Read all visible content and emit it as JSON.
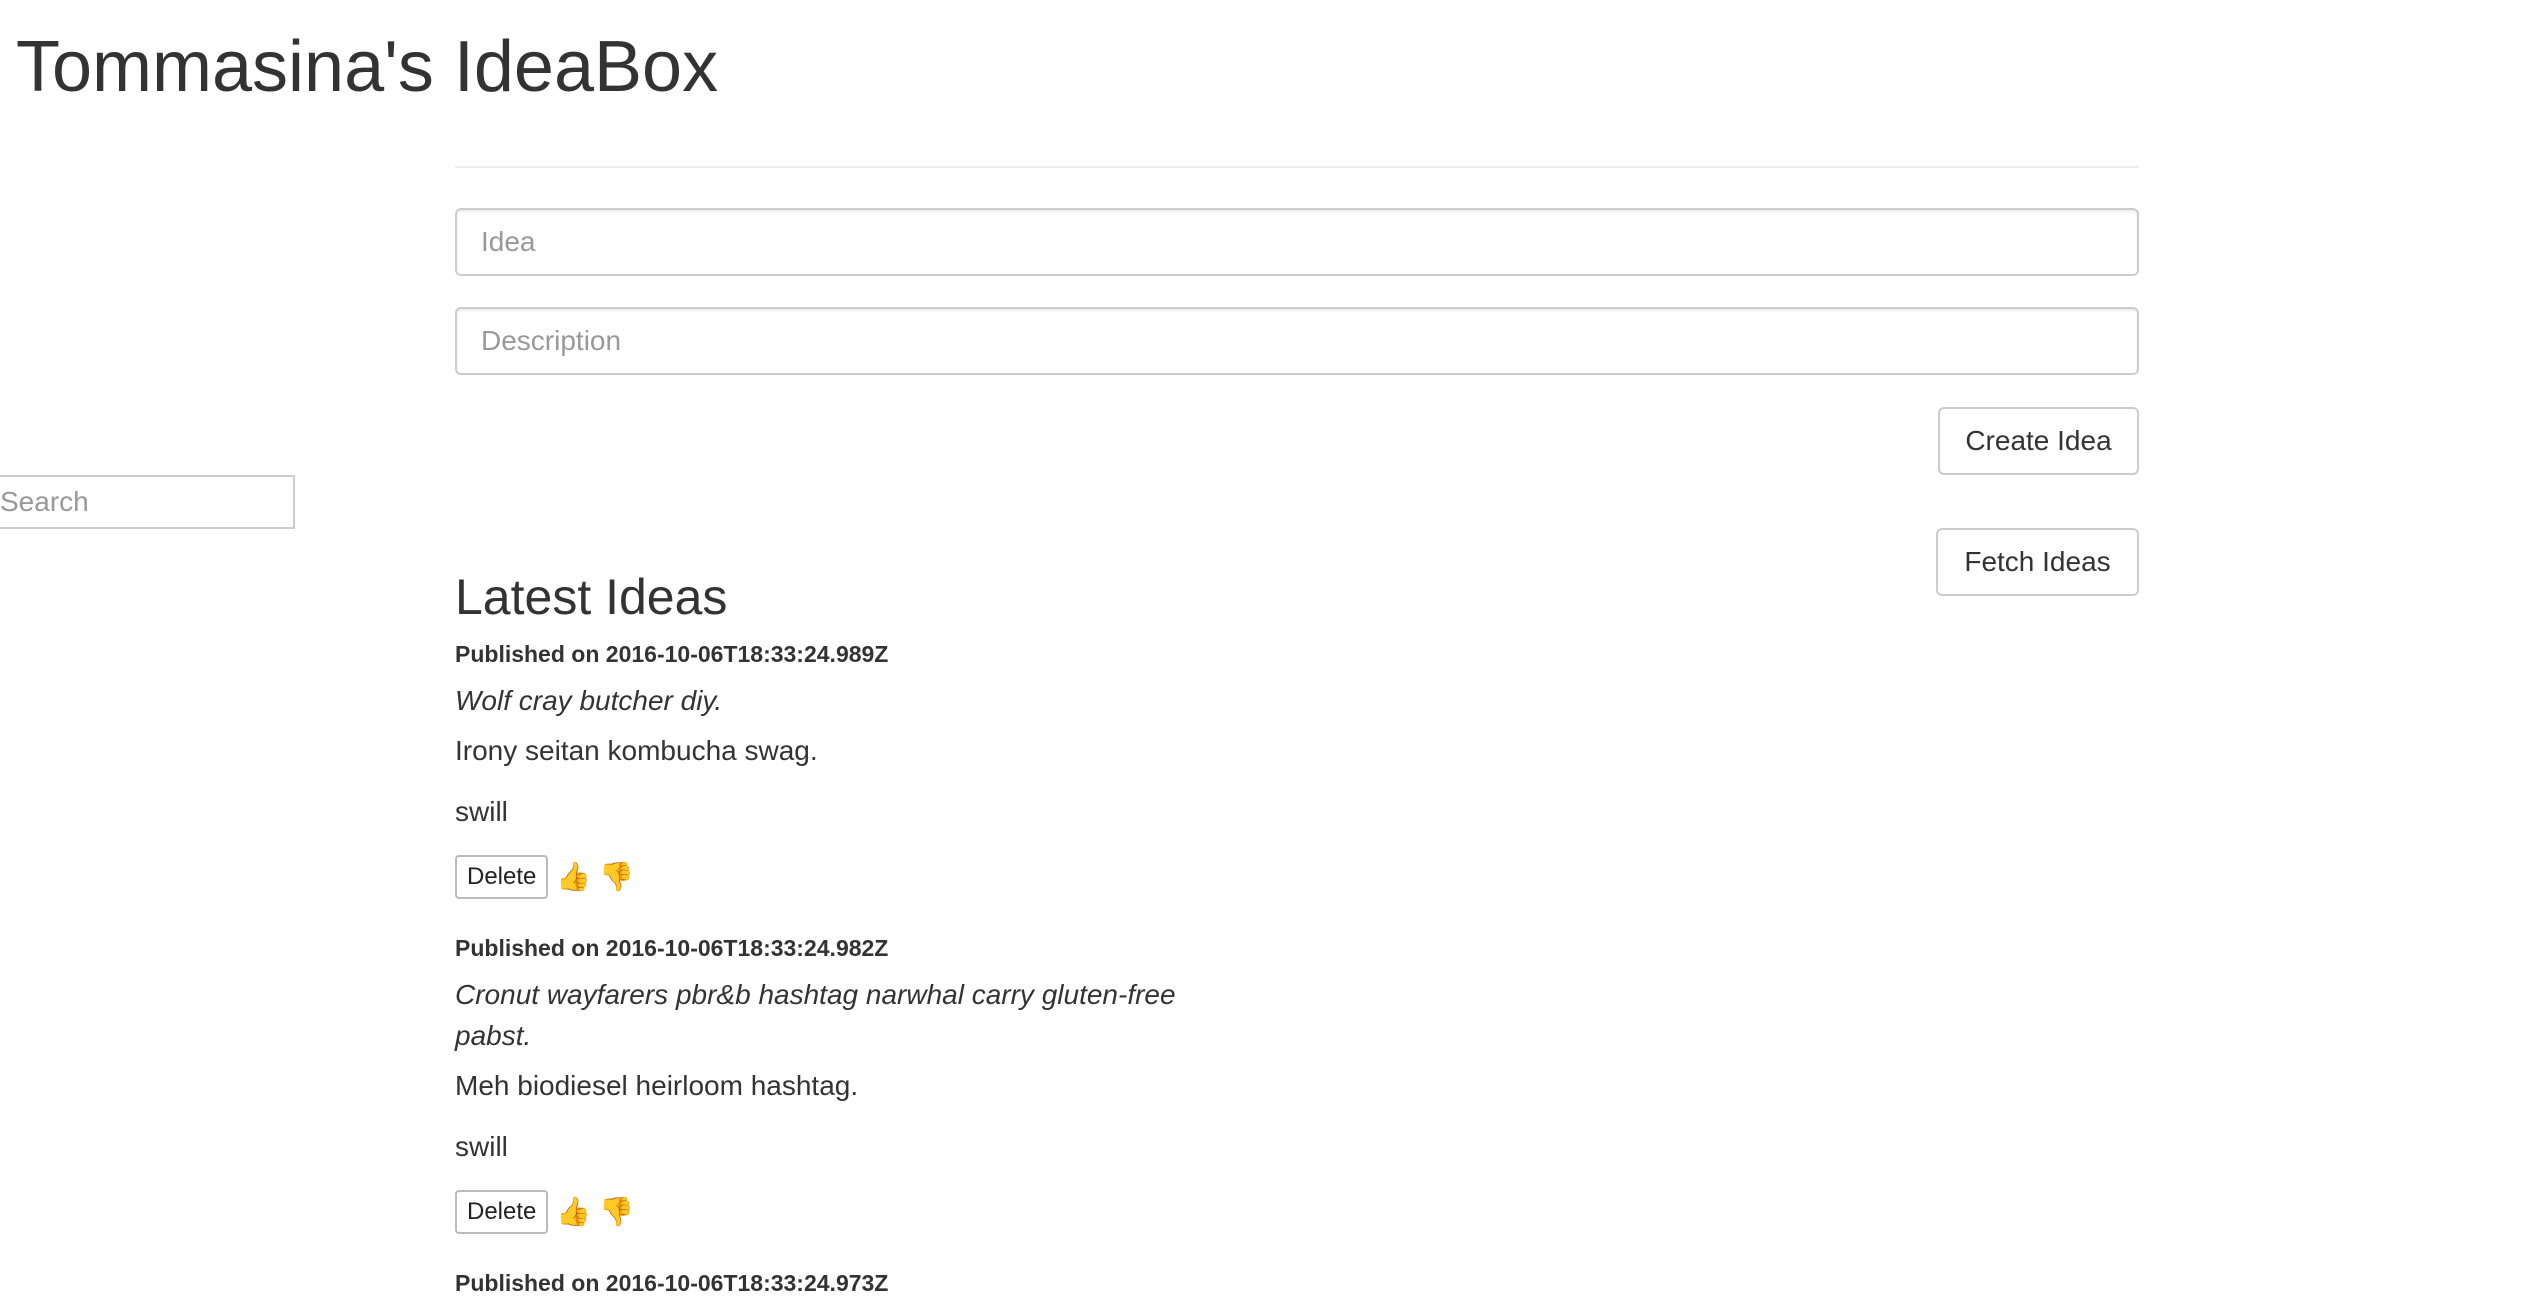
{
  "header": {
    "title": "Tommasina's IdeaBox"
  },
  "form": {
    "idea_placeholder": "Idea",
    "description_placeholder": "Description",
    "create_label": "Create Idea"
  },
  "search": {
    "placeholder": "Search"
  },
  "fetch": {
    "label": "Fetch Ideas"
  },
  "ideas_section": {
    "title": "Latest Ideas",
    "ideas": [
      {
        "published": "Published on 2016-10-06T18:33:24.989Z",
        "title": "Wolf cray butcher diy.",
        "body": "Irony seitan kombucha swag.",
        "quality": "swill",
        "delete_label": "Delete",
        "upvote_icon": "👍",
        "downvote_icon": "👎"
      },
      {
        "published": "Published on 2016-10-06T18:33:24.982Z",
        "title": "Cronut wayfarers pbr&b hashtag narwhal carry gluten-free pabst.",
        "body": "Meh biodiesel heirloom hashtag.",
        "quality": "swill",
        "delete_label": "Delete",
        "upvote_icon": "👍",
        "downvote_icon": "👎"
      },
      {
        "published": "Published on 2016-10-06T18:33:24.973Z"
      }
    ]
  }
}
